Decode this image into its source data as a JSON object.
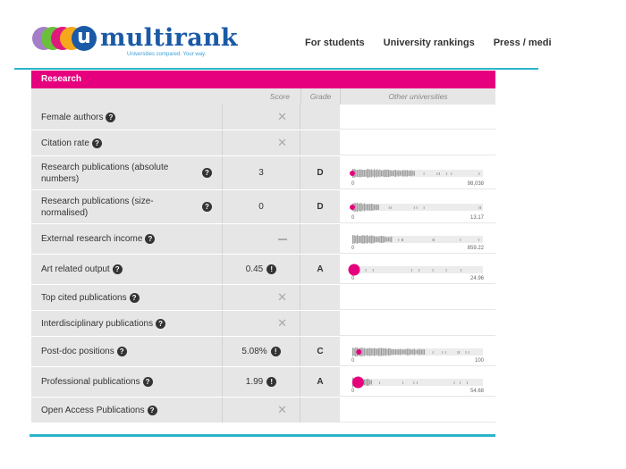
{
  "header": {
    "logo_letter": "u",
    "logo_name": "multirank",
    "logo_tagline": "Universities compared. Your way.",
    "nav": [
      "For students",
      "University rankings",
      "Press / medi"
    ],
    "accent": "#2bb5c9"
  },
  "section": {
    "title": "Research",
    "color": "#e6007e",
    "columns": {
      "score": "Score",
      "grade": "Grade",
      "other": "Other universities"
    }
  },
  "rows": [
    {
      "name": "Female authors",
      "score": "",
      "score_state": "x",
      "grade": "",
      "help": true,
      "name_help_inline": true,
      "chart": null
    },
    {
      "name": "Citation rate",
      "score": "",
      "score_state": "x",
      "grade": "",
      "help": true,
      "name_help_inline": true,
      "chart": null
    },
    {
      "name": "Research publications (absolute numbers)",
      "score": "3",
      "score_state": "value",
      "grade": "D",
      "help": true,
      "name_help_inline": false,
      "chart": {
        "min": "0",
        "max": "98,038",
        "marker": 0.0,
        "marker_size": "small",
        "dense_end": 0.48
      }
    },
    {
      "name": "Research publications (size-normalised)",
      "score": "0",
      "score_state": "value",
      "grade": "D",
      "help": true,
      "name_help_inline": false,
      "chart": {
        "min": "0",
        "max": "13.17",
        "marker": 0.0,
        "marker_size": "small",
        "dense_end": 0.2
      }
    },
    {
      "name": "External research income",
      "score": "",
      "score_state": "dash",
      "grade": "",
      "help": true,
      "name_help_inline": true,
      "chart": {
        "min": "0",
        "max": "859.22",
        "marker": null,
        "marker_size": "none",
        "dense_end": 0.3
      }
    },
    {
      "name": "Art related output",
      "score": "0.45",
      "score_state": "value",
      "warn": true,
      "grade": "A",
      "help": true,
      "name_help_inline": true,
      "chart": {
        "min": "0",
        "max": "24.96",
        "marker": 0.0,
        "marker_size": "large",
        "dense_end": 0.05
      }
    },
    {
      "name": "Top cited publications",
      "score": "",
      "score_state": "x",
      "grade": "",
      "help": true,
      "name_help_inline": true,
      "chart": null
    },
    {
      "name": "Interdisciplinary publications",
      "score": "",
      "score_state": "x",
      "grade": "",
      "help": true,
      "name_help_inline": true,
      "chart": null
    },
    {
      "name": "Post-doc positions",
      "score": "5.08%",
      "score_state": "value",
      "warn": true,
      "grade": "C",
      "help": true,
      "name_help_inline": true,
      "chart": {
        "min": "0",
        "max": "100",
        "marker": 0.05,
        "marker_size": "small",
        "dense_end": 0.55
      }
    },
    {
      "name": "Professional publications",
      "score": "1.99",
      "score_state": "value",
      "warn": true,
      "grade": "A",
      "help": true,
      "name_help_inline": true,
      "chart": {
        "min": "0",
        "max": "54.68",
        "marker": 0.03,
        "marker_size": "large",
        "dense_end": 0.15
      }
    },
    {
      "name": "Open Access Publications",
      "score": "",
      "score_state": "x",
      "grade": "",
      "help": true,
      "name_help_inline": true,
      "chart": null
    }
  ],
  "icons": {
    "help": "question-circle-icon",
    "warning": "exclamation-circle-icon",
    "na": "x-mark-icon"
  }
}
